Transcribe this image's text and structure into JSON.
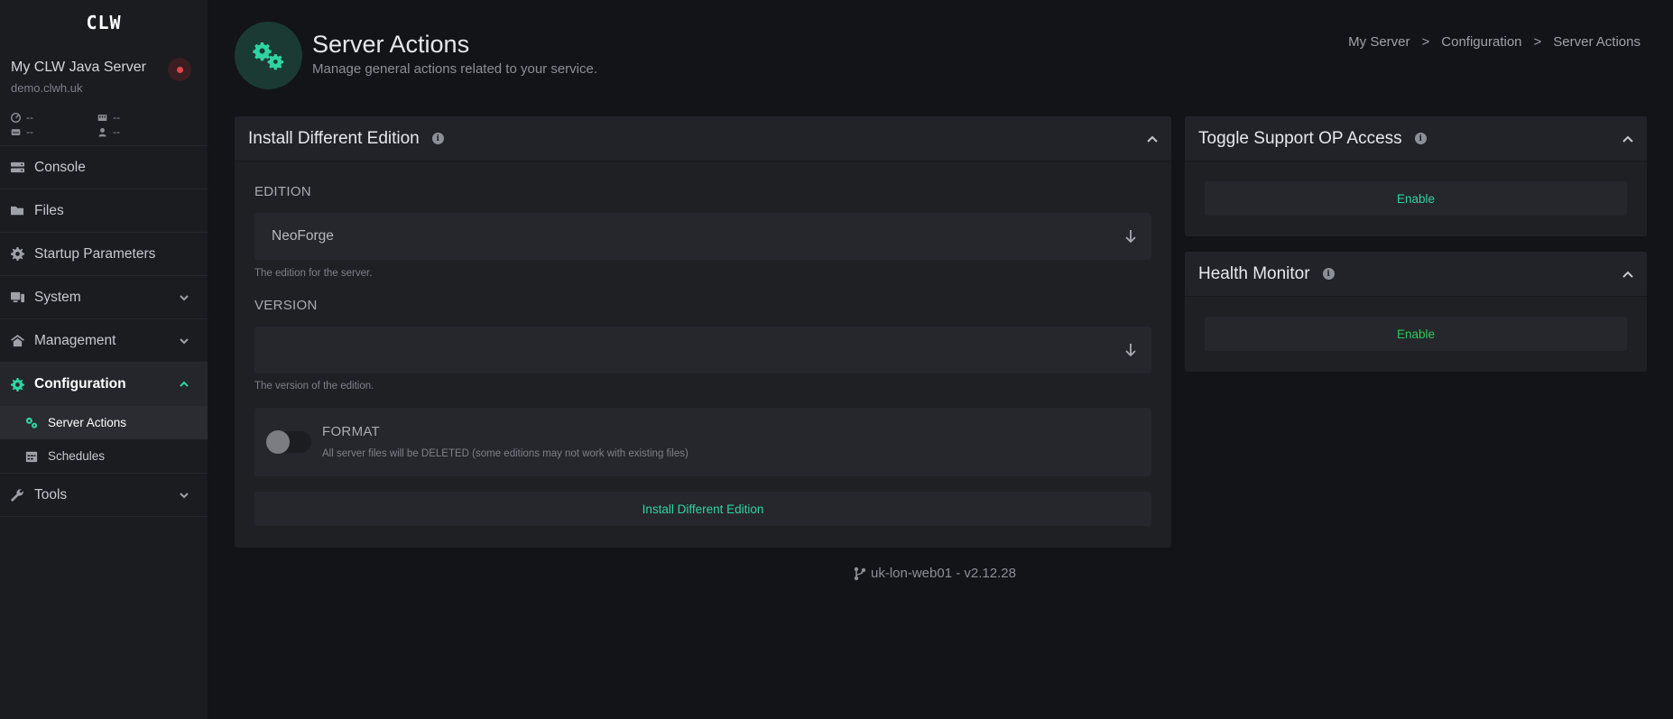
{
  "app": {
    "logo": "CLW"
  },
  "server": {
    "name": "My CLW Java Server",
    "host": "demo.clwh.uk",
    "stats": [
      {
        "icon": "cpu-icon",
        "value": "--"
      },
      {
        "icon": "memory-icon",
        "value": "--"
      },
      {
        "icon": "disk-icon",
        "value": "--"
      },
      {
        "icon": "players-icon",
        "value": "--"
      }
    ],
    "status_color": "#e1454b"
  },
  "sidebar": {
    "items": [
      {
        "label": "Console",
        "icon": "console-icon"
      },
      {
        "label": "Files",
        "icon": "folder-icon"
      },
      {
        "label": "Startup Parameters",
        "icon": "gear-icon"
      },
      {
        "label": "System",
        "icon": "system-icon"
      },
      {
        "label": "Management",
        "icon": "management-icon"
      },
      {
        "label": "Configuration",
        "icon": "gear-icon",
        "active": true
      },
      {
        "label": "Tools",
        "icon": "wrench-icon"
      }
    ],
    "sub_items": [
      {
        "label": "Server Actions",
        "icon": "gears-icon",
        "current": true
      },
      {
        "label": "Schedules",
        "icon": "calendar-icon"
      }
    ]
  },
  "header": {
    "title": "Server Actions",
    "subtitle": "Manage general actions related to your service.",
    "breadcrumb": [
      "My Server",
      "Configuration",
      "Server Actions"
    ],
    "separator": ">"
  },
  "install_panel": {
    "title": "Install Different Edition",
    "edition_label": "EDITION",
    "edition_value": "NeoForge",
    "edition_help": "The edition for the server.",
    "version_label": "VERSION",
    "version_value": "",
    "version_help": "The version of the edition.",
    "format_title": "FORMAT",
    "format_desc": "All server files will be DELETED (some editions may not work with existing files)",
    "format_enabled": false,
    "button_label": "Install Different Edition"
  },
  "support_panel": {
    "title": "Toggle Support OP Access",
    "button_label": "Enable"
  },
  "health_panel": {
    "title": "Health Monitor",
    "button_label": "Enable"
  },
  "footer": {
    "text": "uk-lon-web01 - v2.12.28"
  },
  "colors": {
    "accent": "#2fd4a1",
    "enable_green": "#29c95a",
    "background": "#131417",
    "panel": "#1f2024"
  }
}
